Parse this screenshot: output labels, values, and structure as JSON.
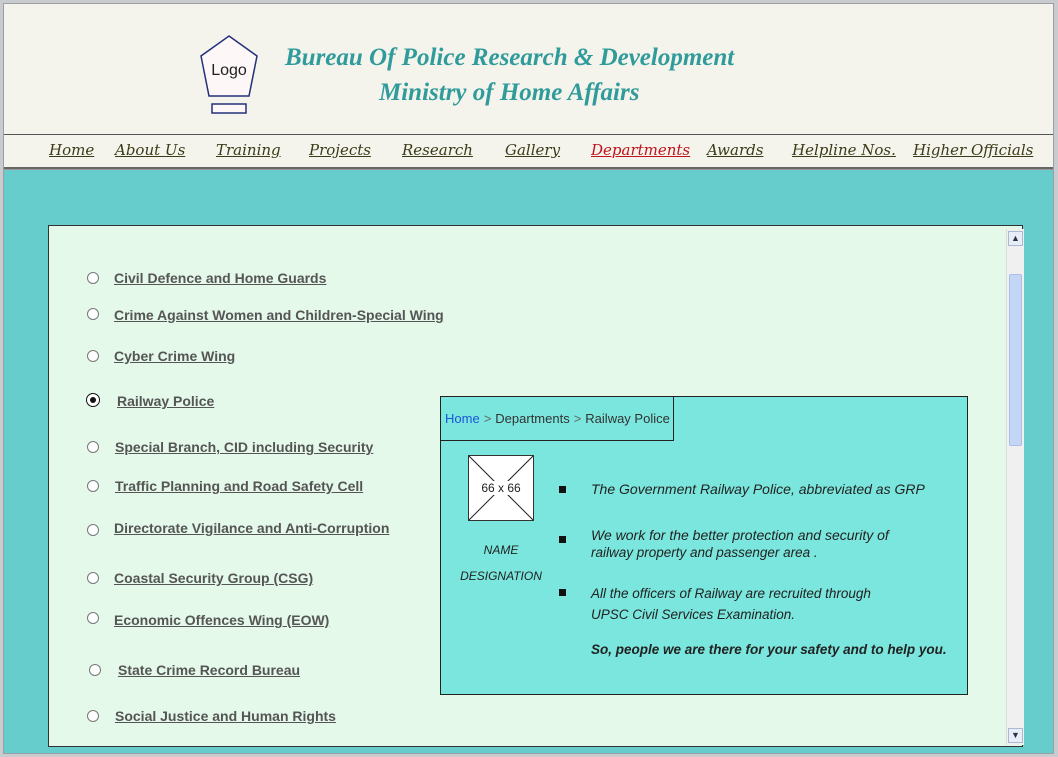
{
  "header": {
    "logo_text": "Logo",
    "title_line1": "Bureau Of Police Research & Development",
    "title_line2": "Ministry of Home Affairs"
  },
  "nav": {
    "items": [
      {
        "label": "Home"
      },
      {
        "label": "About Us"
      },
      {
        "label": "Training"
      },
      {
        "label": "Projects"
      },
      {
        "label": "Research"
      },
      {
        "label": "Gallery"
      },
      {
        "label": "Departments",
        "active": true
      },
      {
        "label": "Awards"
      },
      {
        "label": "Helpline Nos."
      },
      {
        "label": "Higher Officials"
      }
    ]
  },
  "departments": {
    "selected": "Railway Police",
    "items": [
      {
        "label": "Civil Defence and Home Guards"
      },
      {
        "label": "Crime Against Women and Children-Special Wing"
      },
      {
        "label": "Cyber Crime Wing"
      },
      {
        "label": "Railway Police"
      },
      {
        "label": "Special Branch, CID including Security"
      },
      {
        "label": "Traffic Planning and Road Safety Cell"
      },
      {
        "label": "Directorate Vigilance and Anti-Corruption"
      },
      {
        "label": "Coastal Security Group (CSG)"
      },
      {
        "label": "Economic Offences Wing (EOW)"
      },
      {
        "label": "State Crime Record Bureau"
      },
      {
        "label": "Social Justice and Human Rights"
      }
    ]
  },
  "detail": {
    "breadcrumb": {
      "home": "Home",
      "sep": ">",
      "level1": "Departments",
      "level2": "Railway Police"
    },
    "photo_placeholder": "66 x 66",
    "name": "NAME",
    "designation": "DESIGNATION",
    "points": [
      "The Government Railway Police, abbreviated as GRP",
      "We work for the better protection and security of",
      "railway property and passenger area .",
      "All the officers of Railway are recruited through",
      "UPSC Civil Services Examination."
    ],
    "closing": "So, people we are there for your safety and to help you."
  },
  "colors": {
    "page_bg": "#66cdcc",
    "header_bg": "#f4f3ec",
    "title": "#2f9b9a",
    "nav_active": "#c0131b",
    "panel_bg": "#e4f9ea",
    "detail_bg": "#7ae6dd",
    "link_blue": "#1a57d6"
  },
  "icons": {
    "logo": "pentagon-logo-icon",
    "scroll_up": "chevron-up-icon",
    "scroll_down": "chevron-down-icon"
  }
}
